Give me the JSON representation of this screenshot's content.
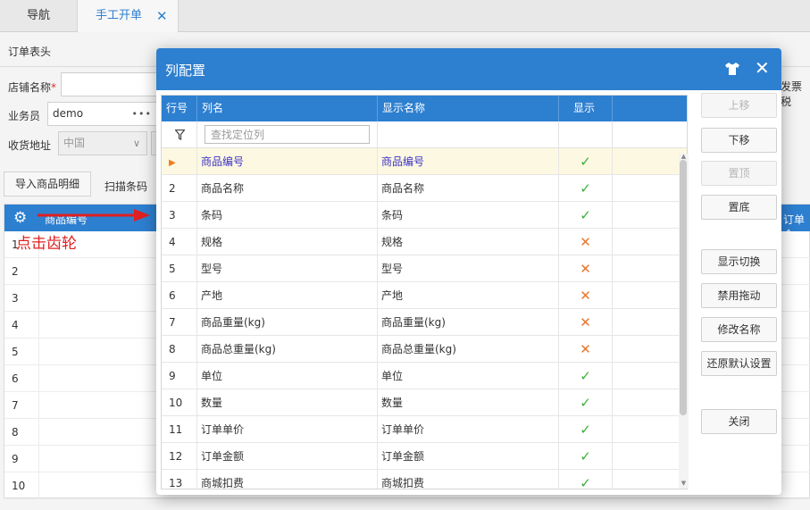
{
  "tabs": [
    {
      "label": "导航"
    },
    {
      "label": "手工开单",
      "close": "✕"
    }
  ],
  "order_header": {
    "title": "订单表头",
    "store_label": "店铺名称",
    "salesperson_label": "业务员",
    "salesperson_value": "demo",
    "address_label": "收货地址",
    "address_country": "中国",
    "right_cut_label": "发票税"
  },
  "toolbar": {
    "import_button": "导入商品明细",
    "scan_button": "扫描条码"
  },
  "background_grid": {
    "header_first": "商品编号",
    "header_last": "订单金",
    "row_numbers": [
      "1",
      "2",
      "3",
      "4",
      "5",
      "6",
      "7",
      "8",
      "9",
      "10"
    ]
  },
  "annotation": {
    "text": "点击齿轮",
    "color": "#e02020"
  },
  "modal": {
    "title": "列配置",
    "close": "✕",
    "columns": {
      "index": "行号",
      "name": "列名",
      "display_name": "显示名称",
      "show": "显示"
    },
    "search_placeholder": "查找定位列",
    "rows": [
      {
        "index": "",
        "name": "商品编号",
        "display": "商品编号",
        "show": true,
        "selected": true
      },
      {
        "index": "2",
        "name": "商品名称",
        "display": "商品名称",
        "show": true
      },
      {
        "index": "3",
        "name": "条码",
        "display": "条码",
        "show": true
      },
      {
        "index": "4",
        "name": "规格",
        "display": "规格",
        "show": false
      },
      {
        "index": "5",
        "name": "型号",
        "display": "型号",
        "show": false
      },
      {
        "index": "6",
        "name": "产地",
        "display": "产地",
        "show": false
      },
      {
        "index": "7",
        "name": "商品重量(kg)",
        "display": "商品重量(kg)",
        "show": false
      },
      {
        "index": "8",
        "name": "商品总重量(kg)",
        "display": "商品总重量(kg)",
        "show": false
      },
      {
        "index": "9",
        "name": "单位",
        "display": "单位",
        "show": true
      },
      {
        "index": "10",
        "name": "数量",
        "display": "数量",
        "show": true
      },
      {
        "index": "11",
        "name": "订单单价",
        "display": "订单单价",
        "show": true
      },
      {
        "index": "12",
        "name": "订单金额",
        "display": "订单金额",
        "show": true
      },
      {
        "index": "13",
        "name": "商城扣费",
        "display": "商城扣费",
        "show": true
      }
    ],
    "buttons": {
      "move_up": "上移",
      "move_down": "下移",
      "to_top": "置顶",
      "to_bottom": "置底",
      "toggle_show": "显示切换",
      "disable_drag": "禁用拖动",
      "rename": "修改名称",
      "restore_default": "还原默认设置",
      "close": "关闭"
    }
  },
  "colors": {
    "accent": "#2d7fd0",
    "check": "#3cae3c",
    "cross": "#e8772e",
    "selected_row": "#fdf8e2"
  }
}
